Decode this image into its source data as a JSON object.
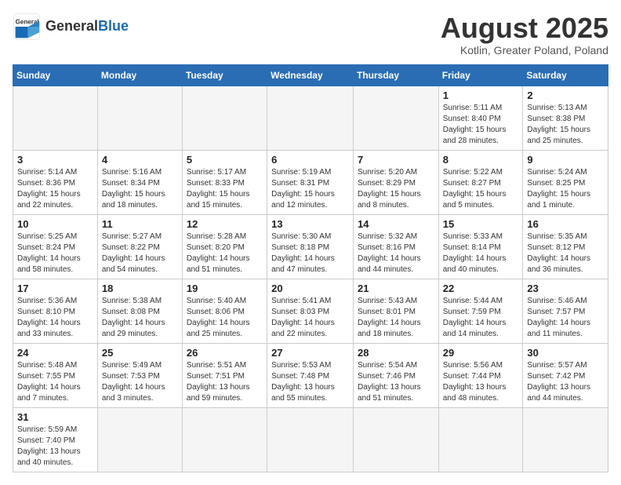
{
  "header": {
    "logo_general": "General",
    "logo_blue": "Blue",
    "title": "August 2025",
    "subtitle": "Kotlin, Greater Poland, Poland"
  },
  "days_of_week": [
    "Sunday",
    "Monday",
    "Tuesday",
    "Wednesday",
    "Thursday",
    "Friday",
    "Saturday"
  ],
  "weeks": [
    [
      {
        "day": "",
        "info": ""
      },
      {
        "day": "",
        "info": ""
      },
      {
        "day": "",
        "info": ""
      },
      {
        "day": "",
        "info": ""
      },
      {
        "day": "",
        "info": ""
      },
      {
        "day": "1",
        "info": "Sunrise: 5:11 AM\nSunset: 8:40 PM\nDaylight: 15 hours and 28 minutes."
      },
      {
        "day": "2",
        "info": "Sunrise: 5:13 AM\nSunset: 8:38 PM\nDaylight: 15 hours and 25 minutes."
      }
    ],
    [
      {
        "day": "3",
        "info": "Sunrise: 5:14 AM\nSunset: 8:36 PM\nDaylight: 15 hours and 22 minutes."
      },
      {
        "day": "4",
        "info": "Sunrise: 5:16 AM\nSunset: 8:34 PM\nDaylight: 15 hours and 18 minutes."
      },
      {
        "day": "5",
        "info": "Sunrise: 5:17 AM\nSunset: 8:33 PM\nDaylight: 15 hours and 15 minutes."
      },
      {
        "day": "6",
        "info": "Sunrise: 5:19 AM\nSunset: 8:31 PM\nDaylight: 15 hours and 12 minutes."
      },
      {
        "day": "7",
        "info": "Sunrise: 5:20 AM\nSunset: 8:29 PM\nDaylight: 15 hours and 8 minutes."
      },
      {
        "day": "8",
        "info": "Sunrise: 5:22 AM\nSunset: 8:27 PM\nDaylight: 15 hours and 5 minutes."
      },
      {
        "day": "9",
        "info": "Sunrise: 5:24 AM\nSunset: 8:25 PM\nDaylight: 15 hours and 1 minute."
      }
    ],
    [
      {
        "day": "10",
        "info": "Sunrise: 5:25 AM\nSunset: 8:24 PM\nDaylight: 14 hours and 58 minutes."
      },
      {
        "day": "11",
        "info": "Sunrise: 5:27 AM\nSunset: 8:22 PM\nDaylight: 14 hours and 54 minutes."
      },
      {
        "day": "12",
        "info": "Sunrise: 5:28 AM\nSunset: 8:20 PM\nDaylight: 14 hours and 51 minutes."
      },
      {
        "day": "13",
        "info": "Sunrise: 5:30 AM\nSunset: 8:18 PM\nDaylight: 14 hours and 47 minutes."
      },
      {
        "day": "14",
        "info": "Sunrise: 5:32 AM\nSunset: 8:16 PM\nDaylight: 14 hours and 44 minutes."
      },
      {
        "day": "15",
        "info": "Sunrise: 5:33 AM\nSunset: 8:14 PM\nDaylight: 14 hours and 40 minutes."
      },
      {
        "day": "16",
        "info": "Sunrise: 5:35 AM\nSunset: 8:12 PM\nDaylight: 14 hours and 36 minutes."
      }
    ],
    [
      {
        "day": "17",
        "info": "Sunrise: 5:36 AM\nSunset: 8:10 PM\nDaylight: 14 hours and 33 minutes."
      },
      {
        "day": "18",
        "info": "Sunrise: 5:38 AM\nSunset: 8:08 PM\nDaylight: 14 hours and 29 minutes."
      },
      {
        "day": "19",
        "info": "Sunrise: 5:40 AM\nSunset: 8:06 PM\nDaylight: 14 hours and 25 minutes."
      },
      {
        "day": "20",
        "info": "Sunrise: 5:41 AM\nSunset: 8:03 PM\nDaylight: 14 hours and 22 minutes."
      },
      {
        "day": "21",
        "info": "Sunrise: 5:43 AM\nSunset: 8:01 PM\nDaylight: 14 hours and 18 minutes."
      },
      {
        "day": "22",
        "info": "Sunrise: 5:44 AM\nSunset: 7:59 PM\nDaylight: 14 hours and 14 minutes."
      },
      {
        "day": "23",
        "info": "Sunrise: 5:46 AM\nSunset: 7:57 PM\nDaylight: 14 hours and 11 minutes."
      }
    ],
    [
      {
        "day": "24",
        "info": "Sunrise: 5:48 AM\nSunset: 7:55 PM\nDaylight: 14 hours and 7 minutes."
      },
      {
        "day": "25",
        "info": "Sunrise: 5:49 AM\nSunset: 7:53 PM\nDaylight: 14 hours and 3 minutes."
      },
      {
        "day": "26",
        "info": "Sunrise: 5:51 AM\nSunset: 7:51 PM\nDaylight: 13 hours and 59 minutes."
      },
      {
        "day": "27",
        "info": "Sunrise: 5:53 AM\nSunset: 7:48 PM\nDaylight: 13 hours and 55 minutes."
      },
      {
        "day": "28",
        "info": "Sunrise: 5:54 AM\nSunset: 7:46 PM\nDaylight: 13 hours and 51 minutes."
      },
      {
        "day": "29",
        "info": "Sunrise: 5:56 AM\nSunset: 7:44 PM\nDaylight: 13 hours and 48 minutes."
      },
      {
        "day": "30",
        "info": "Sunrise: 5:57 AM\nSunset: 7:42 PM\nDaylight: 13 hours and 44 minutes."
      }
    ],
    [
      {
        "day": "31",
        "info": "Sunrise: 5:59 AM\nSunset: 7:40 PM\nDaylight: 13 hours and 40 minutes."
      },
      {
        "day": "",
        "info": ""
      },
      {
        "day": "",
        "info": ""
      },
      {
        "day": "",
        "info": ""
      },
      {
        "day": "",
        "info": ""
      },
      {
        "day": "",
        "info": ""
      },
      {
        "day": "",
        "info": ""
      }
    ]
  ]
}
